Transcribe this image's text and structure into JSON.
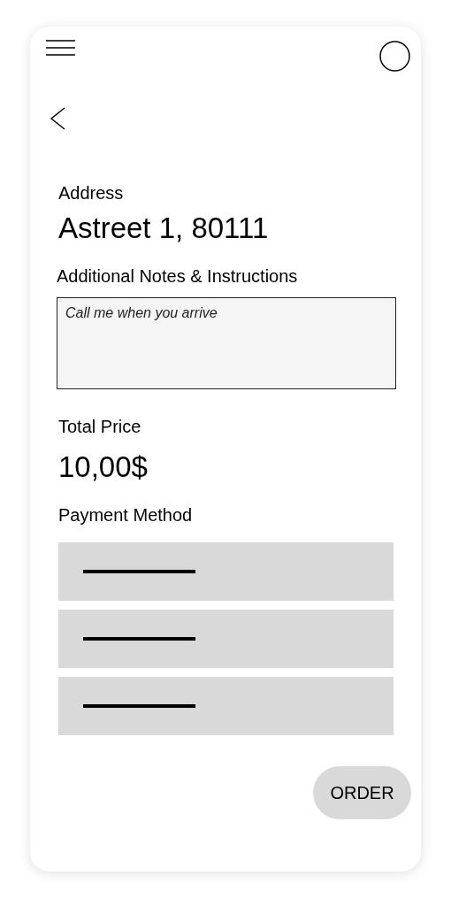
{
  "address": {
    "label": "Address",
    "value": "Astreet 1, 80111"
  },
  "notes": {
    "label": "Additional Notes & Instructions",
    "value": "Call me when you arrive"
  },
  "total": {
    "label": "Total Price",
    "value": "10,00$"
  },
  "payment": {
    "label": "Payment Method",
    "options": [
      {
        "kind": "placeholder"
      },
      {
        "kind": "placeholder"
      },
      {
        "kind": "placeholder"
      }
    ]
  },
  "order_button": "ORDER"
}
